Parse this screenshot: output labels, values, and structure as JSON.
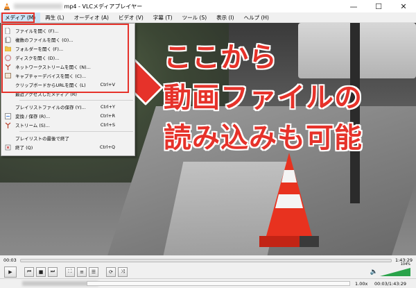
{
  "window": {
    "title_suffix": "mp4 - VLCメディアプレイヤー",
    "minimize_label": "—",
    "maximize_label": "☐",
    "close_label": "✕"
  },
  "menubar": {
    "items": [
      {
        "label": "メディア (M)"
      },
      {
        "label": "再生 (L)"
      },
      {
        "label": "オーディオ (A)"
      },
      {
        "label": "ビデオ (V)"
      },
      {
        "label": "字幕 (T)"
      },
      {
        "label": "ツール (S)"
      },
      {
        "label": "表示 (I)"
      },
      {
        "label": "ヘルプ (H)"
      }
    ]
  },
  "media_menu": {
    "items": [
      {
        "label": "ファイルを開く (F)...",
        "shortcut": "",
        "icon": "file-icon"
      },
      {
        "label": "複数のファイルを開く (O)...",
        "shortcut": "",
        "icon": "files-icon"
      },
      {
        "label": "フォルダーを開く (F)...",
        "shortcut": "",
        "icon": "folder-icon"
      },
      {
        "label": "ディスクを開く (D)...",
        "shortcut": "",
        "icon": "disc-icon"
      },
      {
        "label": "ネットワークストリームを開く (N)...",
        "shortcut": "",
        "icon": "network-icon"
      },
      {
        "label": "キャプチャーデバイスを開く (C)...",
        "shortcut": "",
        "icon": "capture-icon"
      },
      {
        "label": "クリップボードからURLを開く (L)",
        "shortcut": "Ctrl+V",
        "icon": ""
      },
      {
        "label": "最近アクセスしたメディア (R)",
        "shortcut": "",
        "icon": ""
      },
      {
        "label": "プレイリストファイルの保存 (Y)...",
        "shortcut": "Ctrl+Y",
        "icon": ""
      },
      {
        "label": "変換 / 保存 (R)...",
        "shortcut": "Ctrl+R",
        "icon": "convert-icon"
      },
      {
        "label": "ストリーム (S)...",
        "shortcut": "Ctrl+S",
        "icon": "stream-icon"
      },
      {
        "label": "プレイリストの最後で終了",
        "shortcut": "",
        "icon": ""
      },
      {
        "label": "終了 (Q)",
        "shortcut": "Ctrl+Q",
        "icon": "quit-icon"
      }
    ]
  },
  "annotation": {
    "line1": "ここから",
    "line2": "動画ファイルの",
    "line3": "読み込みも可能"
  },
  "player": {
    "elapsed": "00:03",
    "total": "1:43:29",
    "progress_fraction": 0.0,
    "volume_percent": "104%",
    "speed": "1.00x",
    "status_time": "00:03/1:43:29"
  },
  "colors": {
    "accent_red": "#e6322a",
    "seek_blue": "#3b7bd6",
    "volume_green": "#2aa34a"
  }
}
